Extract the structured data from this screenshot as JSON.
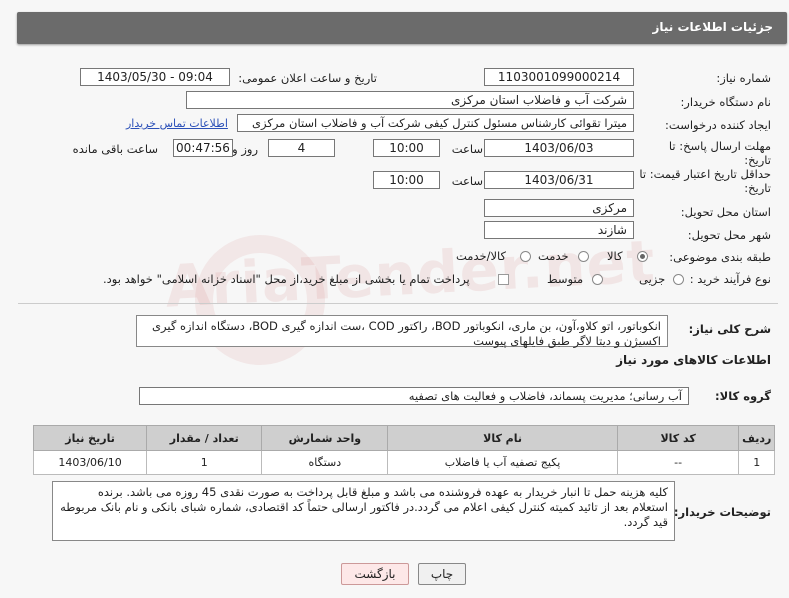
{
  "header": {
    "title": "جزئیات اطلاعات نیاز"
  },
  "fields": {
    "need_number_label": "شماره نیاز:",
    "need_number": "1103001099000214",
    "announce_label": "تاریخ و ساعت اعلان عمومی:",
    "announce_value": "1403/05/30 - 09:04",
    "buyer_label": "نام دستگاه خریدار:",
    "buyer_value": "شرکت آب و فاضلاب استان مرکزی",
    "creator_label": "ایجاد کننده درخواست:",
    "creator_value": "میترا تقوائی کارشناس مسئول کنترل کیفی شرکت آب و فاضلاب استان مرکزی",
    "contact_link": "اطلاعات تماس خریدار",
    "reply_deadline_label": "مهلت ارسال پاسخ: تا تاریخ:",
    "reply_date": "1403/06/03",
    "time_label": "ساعت",
    "reply_time": "10:00",
    "days_value": "4",
    "days_label": "روز و",
    "remaining_time": "00:47:56",
    "remaining_label": "ساعت باقی مانده",
    "price_validity_label": "حداقل تاریخ اعتبار قیمت: تا تاریخ:",
    "validity_date": "1403/06/31",
    "validity_time": "10:00",
    "province_label": "استان محل تحویل:",
    "province_value": "مرکزی",
    "city_label": "شهر محل تحویل:",
    "city_value": "شازند",
    "category_label": "طبقه بندی موضوعی:",
    "category_options": [
      "کالا",
      "خدمت",
      "کالا/خدمت"
    ],
    "process_label": "نوع فرآیند خرید :",
    "process_options": [
      "جزیی",
      "متوسط"
    ],
    "payment_note": "پرداخت تمام یا بخشی از مبلغ خرید،از محل \"اسناد خزانه اسلامی\" خواهد بود.",
    "description_label": "شرح کلی نیاز:",
    "description_value": "انکوباتور، اتو کلاو،آون، بن ماری، انکوباتور BOD، راکتور COD ،ست اندازه گیری BOD، دستگاه اندازه گیری اکسیژن و دیتا لاگر طبق فایلهای پیوست"
  },
  "goods": {
    "section_title": "اطلاعات کالاهای مورد نیاز",
    "group_label": "گروه کالا:",
    "group_value": "آب رسانی؛ مدیریت پسماند، فاضلاب و فعالیت های تصفیه",
    "columns": [
      "ردیف",
      "کد کالا",
      "نام کالا",
      "واحد شمارش",
      "تعداد / مقدار",
      "تاریخ نیاز"
    ],
    "rows": [
      {
        "row": "1",
        "code": "--",
        "name": "پکیج تصفیه آب یا فاضلاب",
        "unit": "دستگاه",
        "qty": "1",
        "date": "1403/06/10"
      }
    ]
  },
  "buyer_notes": {
    "label": "توضیحات خریدار:",
    "text": "کلیه هزینه حمل تا انبار خریدار به عهده فروشنده می باشد و مبلغ قابل پرداخت به صورت نقدی 45 روزه می باشد. برنده استعلام بعد از تائید کمیته کنترل کیفی اعلام می گردد.در فاکتور ارسالی حتماً کد اقتصادی، شماره شبای بانکی و نام بانک مربوطه قید گردد."
  },
  "buttons": {
    "print": "چاپ",
    "back": "بازگشت"
  },
  "watermark": "AriaTender.net"
}
